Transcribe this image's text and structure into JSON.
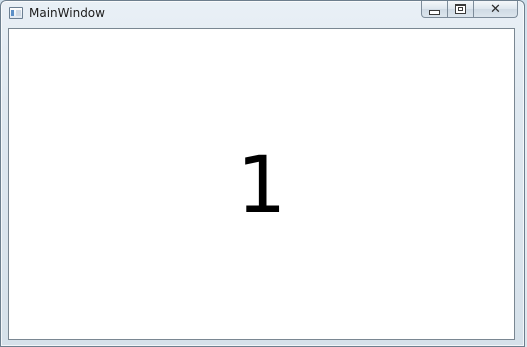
{
  "window": {
    "title": "MainWindow",
    "icon": "app-window-icon",
    "buttons": {
      "minimize_icon": "minimize-icon",
      "maximize_icon": "maximize-icon",
      "close_icon": "close-icon",
      "close_glyph": "✕"
    }
  },
  "content": {
    "value": "1"
  }
}
